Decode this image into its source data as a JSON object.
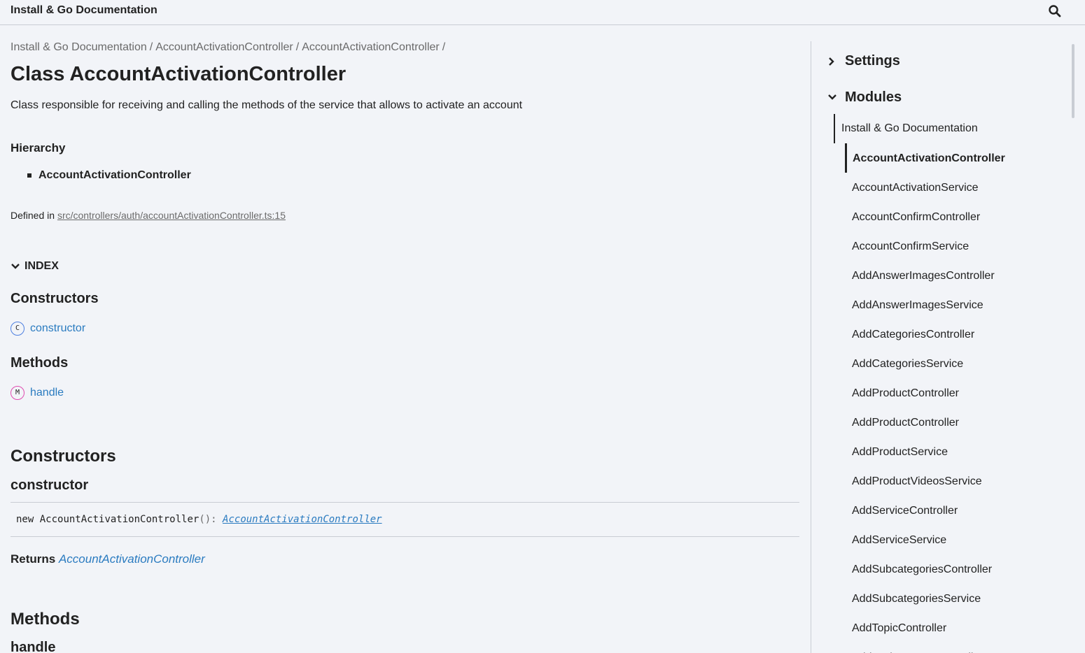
{
  "header": {
    "title": "Install & Go Documentation",
    "search_icon": "search-icon"
  },
  "breadcrumb": {
    "items": [
      "Install & Go Documentation",
      "AccountActivationController",
      "AccountActivationController"
    ],
    "separator": "/"
  },
  "page": {
    "title": "Class AccountActivationController",
    "summary": "Class responsible for receiving and calling the methods of the service that allows to activate an account",
    "hierarchy_heading": "Hierarchy",
    "hierarchy_item": "AccountActivationController",
    "defined_in_label": "Defined in",
    "defined_in_link": "src/controllers/auth/accountActivationController.ts:15"
  },
  "index": {
    "toggle_label": "INDEX",
    "groups": [
      {
        "heading": "Constructors",
        "badge": "C",
        "badge_color": "#4d7fe0",
        "link": "constructor"
      },
      {
        "heading": "Methods",
        "badge": "M",
        "badge_color": "#e04bb0",
        "link": "handle"
      }
    ]
  },
  "constructors_section": {
    "heading": "Constructors",
    "member": "constructor",
    "signature": {
      "keyword": "new",
      "name": "AccountActivationController",
      "parens": "(): ",
      "type": "AccountActivationController"
    },
    "returns_label": "Returns",
    "returns_type": "AccountActivationController"
  },
  "methods_section": {
    "heading": "Methods",
    "member": "handle"
  },
  "sidebar": {
    "settings_label": "Settings",
    "modules_label": "Modules",
    "root": "Install & Go Documentation",
    "active": "AccountActivationController",
    "items": [
      "AccountActivationService",
      "AccountConfirmController",
      "AccountConfirmService",
      "AddAnswerImagesController",
      "AddAnswerImagesService",
      "AddCategoriesController",
      "AddCategoriesService",
      "AddProductController",
      "AddProductController",
      "AddProductService",
      "AddProductVideosService",
      "AddServiceController",
      "AddServiceService",
      "AddSubcategoriesController",
      "AddSubcategoriesService",
      "AddTopicController",
      "AddTopicImagesController"
    ]
  },
  "colors": {
    "link": "#2a7bc0",
    "background": "#f2f4f8",
    "border": "#c9cdd4"
  }
}
